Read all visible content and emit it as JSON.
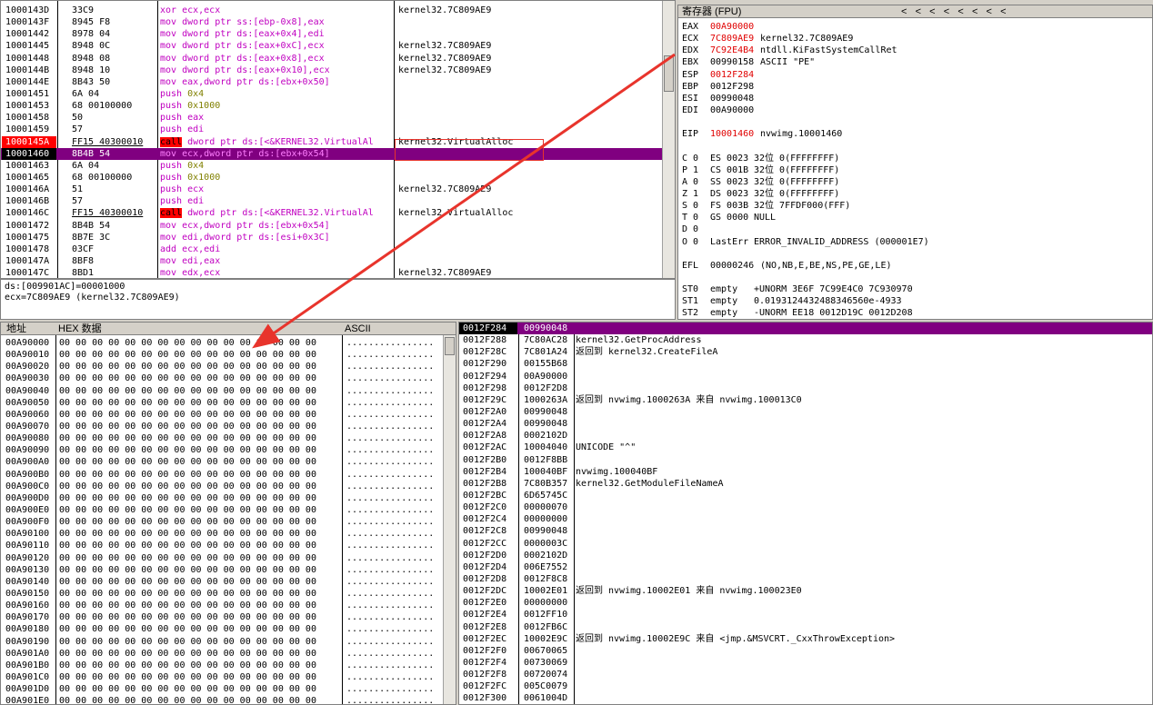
{
  "disasm": {
    "rows": [
      {
        "addr": "1000143D",
        "hex": "33C9",
        "asm": [
          [
            "kw",
            "xor"
          ],
          [
            "b",
            " ecx,ecx"
          ]
        ],
        "cmt": "kernel32.7C809AE9"
      },
      {
        "addr": "1000143F",
        "hex": "8945 F8",
        "asm": [
          [
            "kw",
            "mov"
          ],
          [
            "b",
            " dword ptr ss:[ebp-0x8],eax"
          ]
        ],
        "cmt": ""
      },
      {
        "addr": "10001442",
        "hex": "8978 04",
        "asm": [
          [
            "kw",
            "mov"
          ],
          [
            "b",
            " dword ptr ds:[eax+0x4],edi"
          ]
        ],
        "cmt": ""
      },
      {
        "addr": "10001445",
        "hex": "8948 0C",
        "asm": [
          [
            "kw",
            "mov"
          ],
          [
            "b",
            " dword ptr ds:[eax+0xC],ecx"
          ]
        ],
        "cmt": "kernel32.7C809AE9"
      },
      {
        "addr": "10001448",
        "hex": "8948 08",
        "asm": [
          [
            "kw",
            "mov"
          ],
          [
            "b",
            " dword ptr ds:[eax+0x8],ecx"
          ]
        ],
        "cmt": "kernel32.7C809AE9"
      },
      {
        "addr": "1000144B",
        "hex": "8948 10",
        "asm": [
          [
            "kw",
            "mov"
          ],
          [
            "b",
            " dword ptr ds:[eax+0x10],ecx"
          ]
        ],
        "cmt": "kernel32.7C809AE9"
      },
      {
        "addr": "1000144E",
        "hex": "8B43 50",
        "asm": [
          [
            "kw",
            "mov"
          ],
          [
            "b",
            " eax,dword ptr ds:[ebx+0x50]"
          ]
        ],
        "cmt": ""
      },
      {
        "addr": "10001451",
        "hex": "6A 04",
        "asm": [
          [
            "p",
            "push"
          ],
          [
            "o",
            " 0x4"
          ]
        ],
        "cmt": ""
      },
      {
        "addr": "10001453",
        "hex": "68 00100000",
        "asm": [
          [
            "p",
            "push"
          ],
          [
            "o",
            " 0x1000"
          ]
        ],
        "cmt": ""
      },
      {
        "addr": "10001458",
        "hex": "50",
        "asm": [
          [
            "p",
            "push"
          ],
          [
            "b",
            " eax"
          ]
        ],
        "cmt": ""
      },
      {
        "addr": "10001459",
        "hex": "57",
        "asm": [
          [
            "p",
            "push"
          ],
          [
            "b",
            " edi"
          ]
        ],
        "cmt": ""
      },
      {
        "addr": "1000145A",
        "hex": "FF15 40300010",
        "asm": [
          [
            "call",
            "call"
          ],
          [
            "b",
            " dword ptr ds:[<&KERNEL32.VirtualAl"
          ]
        ],
        "cmt": "kernel32.VirtualAlloc",
        "mark": "bp"
      },
      {
        "addr": "10001460",
        "hex": "8B4B 54",
        "asm": [
          [
            "kw",
            "mov"
          ],
          [
            "b",
            " ecx,dword ptr ds:[ebx+0x54]"
          ]
        ],
        "cmt": "",
        "mark": "eip"
      },
      {
        "addr": "10001463",
        "hex": "6A 04",
        "asm": [
          [
            "p",
            "push"
          ],
          [
            "o",
            " 0x4"
          ]
        ],
        "cmt": ""
      },
      {
        "addr": "10001465",
        "hex": "68 00100000",
        "asm": [
          [
            "p",
            "push"
          ],
          [
            "o",
            " 0x1000"
          ]
        ],
        "cmt": ""
      },
      {
        "addr": "1000146A",
        "hex": "51",
        "asm": [
          [
            "p",
            "push"
          ],
          [
            "b",
            " ecx"
          ]
        ],
        "cmt": "kernel32.7C809AE9"
      },
      {
        "addr": "1000146B",
        "hex": "57",
        "asm": [
          [
            "p",
            "push"
          ],
          [
            "b",
            " edi"
          ]
        ],
        "cmt": ""
      },
      {
        "addr": "1000146C",
        "hex": "FF15 40300010",
        "asm": [
          [
            "call",
            "call"
          ],
          [
            "b",
            " dword ptr ds:[<&KERNEL32.VirtualAl"
          ]
        ],
        "cmt": "kernel32.VirtualAlloc"
      },
      {
        "addr": "10001472",
        "hex": "8B4B 54",
        "asm": [
          [
            "kw",
            "mov"
          ],
          [
            "b",
            " ecx,dword ptr ds:[ebx+0x54]"
          ]
        ],
        "cmt": ""
      },
      {
        "addr": "10001475",
        "hex": "8B7E 3C",
        "asm": [
          [
            "kw",
            "mov"
          ],
          [
            "b",
            " edi,dword ptr ds:[esi+0x3C]"
          ]
        ],
        "cmt": ""
      },
      {
        "addr": "10001478",
        "hex": "03CF",
        "asm": [
          [
            "kw",
            "add"
          ],
          [
            "b",
            " ecx,edi"
          ]
        ],
        "cmt": ""
      },
      {
        "addr": "1000147A",
        "hex": "8BF8",
        "asm": [
          [
            "kw",
            "mov"
          ],
          [
            "b",
            " edi,eax"
          ]
        ],
        "cmt": ""
      },
      {
        "addr": "1000147C",
        "hex": "8BD1",
        "asm": [
          [
            "kw",
            "mov"
          ],
          [
            "b",
            " edx,ecx"
          ]
        ],
        "cmt": "kernel32.7C809AE9"
      }
    ],
    "info1": "ds:[009901AC]=00001000",
    "info2": "ecx=7C809AE9 (kernel32.7C809AE9)"
  },
  "registers": {
    "title": "寄存器 (FPU)",
    "arrows": "<   <   <   <   <   <   <   <",
    "lines": [
      {
        "n": "EAX",
        "v": "00A90000",
        "vc": "red",
        "c": ""
      },
      {
        "n": "ECX",
        "v": "7C809AE9",
        "vc": "red",
        "c": "kernel32.7C809AE9"
      },
      {
        "n": "EDX",
        "v": "7C92E4B4",
        "vc": "red",
        "c": "ntdll.KiFastSystemCallRet"
      },
      {
        "n": "EBX",
        "v": "00990158",
        "vc": "",
        "c": "ASCII \"PE\""
      },
      {
        "n": "ESP",
        "v": "0012F284",
        "vc": "red",
        "c": ""
      },
      {
        "n": "EBP",
        "v": "0012F298",
        "vc": "",
        "c": ""
      },
      {
        "n": "ESI",
        "v": "00990048",
        "vc": "",
        "c": ""
      },
      {
        "n": "EDI",
        "v": "00A90000",
        "vc": "",
        "c": ""
      },
      {
        "n": "",
        "v": "",
        "vc": "",
        "c": ""
      },
      {
        "n": "EIP",
        "v": "10001460",
        "vc": "red",
        "c": "nvwimg.10001460"
      },
      {
        "n": "",
        "v": "",
        "vc": "",
        "c": ""
      },
      {
        "n": "C 0",
        "v": "ES 0023",
        "vc": "",
        "c": "32位 0(FFFFFFFF)"
      },
      {
        "n": "P 1",
        "v": "CS 001B",
        "vc": "",
        "c": "32位 0(FFFFFFFF)"
      },
      {
        "n": "A 0",
        "v": "SS 0023",
        "vc": "",
        "c": "32位 0(FFFFFFFF)"
      },
      {
        "n": "Z 1",
        "v": "DS 0023",
        "vc": "",
        "c": "32位 0(FFFFFFFF)"
      },
      {
        "n": "S 0",
        "v": "FS 003B",
        "vc": "",
        "c": "32位 7FFDF000(FFF)"
      },
      {
        "n": "T 0",
        "v": "GS 0000",
        "vc": "",
        "c": "NULL"
      },
      {
        "n": "D 0",
        "v": "",
        "vc": "",
        "c": ""
      },
      {
        "n": "O 0",
        "v": "LastErr",
        "vc": "",
        "c": "ERROR_INVALID_ADDRESS (000001E7)"
      },
      {
        "n": "",
        "v": "",
        "vc": "",
        "c": ""
      },
      {
        "n": "EFL",
        "v": "00000246",
        "vc": "",
        "c": "(NO,NB,E,BE,NS,PE,GE,LE)"
      },
      {
        "n": "",
        "v": "",
        "vc": "",
        "c": ""
      },
      {
        "n": "ST0",
        "v": "empty",
        "vc": "",
        "c": "+UNORM 3E6F 7C99E4C0 7C930970"
      },
      {
        "n": "ST1",
        "v": "empty",
        "vc": "",
        "c": "0.0193124432488346560e-4933"
      },
      {
        "n": "ST2",
        "v": "empty",
        "vc": "",
        "c": "-UNORM EE18 0012D19C 0012D208"
      },
      {
        "n": "ST3",
        "v": "empty",
        "vc": "",
        "c": "+UNORM 0045 0012D1AC 0012D002"
      },
      {
        "n": "ST4",
        "v": "empty",
        "vc": "",
        "c": "-UNORM D2B0 005BAF28 008C008A"
      }
    ]
  },
  "dump": {
    "col_addr": "地址",
    "col_hex": "HEX 数据",
    "col_ascii": "ASCII",
    "hexline": "00 00 00 00 00 00 00 00 00 00 00 00 00 00 00 00",
    "asciiline": "................",
    "addrs": [
      "00A90000",
      "00A90010",
      "00A90020",
      "00A90030",
      "00A90040",
      "00A90050",
      "00A90060",
      "00A90070",
      "00A90080",
      "00A90090",
      "00A900A0",
      "00A900B0",
      "00A900C0",
      "00A900D0",
      "00A900E0",
      "00A900F0",
      "00A90100",
      "00A90110",
      "00A90120",
      "00A90130",
      "00A90140",
      "00A90150",
      "00A90160",
      "00A90170",
      "00A90180",
      "00A90190",
      "00A901A0",
      "00A901B0",
      "00A901C0",
      "00A901D0",
      "00A901E0"
    ]
  },
  "stack": {
    "rows": [
      {
        "a": "0012F284",
        "v": "00990048",
        "c": "",
        "sel": true
      },
      {
        "a": "0012F288",
        "v": "7C80AC28",
        "c": "kernel32.GetProcAddress"
      },
      {
        "a": "0012F28C",
        "v": "7C801A24",
        "c": "返回到 kernel32.CreateFileA"
      },
      {
        "a": "0012F290",
        "v": "00155B68",
        "c": ""
      },
      {
        "a": "0012F294",
        "v": "00A90000",
        "c": ""
      },
      {
        "a": "0012F298",
        "v": "0012F2D8",
        "c": ""
      },
      {
        "a": "0012F29C",
        "v": "1000263A",
        "c": "返回到 nvwimg.1000263A 来自 nvwimg.100013C0"
      },
      {
        "a": "0012F2A0",
        "v": "00990048",
        "c": ""
      },
      {
        "a": "0012F2A4",
        "v": "00990048",
        "c": ""
      },
      {
        "a": "0012F2A8",
        "v": "0002102D",
        "c": ""
      },
      {
        "a": "0012F2AC",
        "v": "10004040",
        "c": "UNICODE \"^\""
      },
      {
        "a": "0012F2B0",
        "v": "0012F8BB",
        "c": ""
      },
      {
        "a": "0012F2B4",
        "v": "100040BF",
        "c": "nvwimg.100040BF"
      },
      {
        "a": "0012F2B8",
        "v": "7C80B357",
        "c": "kernel32.GetModuleFileNameA"
      },
      {
        "a": "0012F2BC",
        "v": "6D65745C",
        "c": ""
      },
      {
        "a": "0012F2C0",
        "v": "00000070",
        "c": ""
      },
      {
        "a": "0012F2C4",
        "v": "00000000",
        "c": ""
      },
      {
        "a": "0012F2C8",
        "v": "00990048",
        "c": ""
      },
      {
        "a": "0012F2CC",
        "v": "0000003C",
        "c": ""
      },
      {
        "a": "0012F2D0",
        "v": "0002102D",
        "c": ""
      },
      {
        "a": "0012F2D4",
        "v": "006E7552",
        "c": ""
      },
      {
        "a": "0012F2D8",
        "v": "0012F8C8",
        "c": ""
      },
      {
        "a": "0012F2DC",
        "v": "10002E01",
        "c": "返回到 nvwimg.10002E01 来自 nvwimg.100023E0"
      },
      {
        "a": "0012F2E0",
        "v": "00000000",
        "c": ""
      },
      {
        "a": "0012F2E4",
        "v": "0012FF10",
        "c": ""
      },
      {
        "a": "0012F2E8",
        "v": "0012FB6C",
        "c": ""
      },
      {
        "a": "0012F2EC",
        "v": "10002E9C",
        "c": "返回到 nvwimg.10002E9C 来自 <jmp.&MSVCRT._CxxThrowException>"
      },
      {
        "a": "0012F2F0",
        "v": "00670065",
        "c": ""
      },
      {
        "a": "0012F2F4",
        "v": "00730069",
        "c": ""
      },
      {
        "a": "0012F2F8",
        "v": "00720074",
        "c": ""
      },
      {
        "a": "0012F2FC",
        "v": "005C0079",
        "c": ""
      },
      {
        "a": "0012F300",
        "v": "0061004D",
        "c": ""
      }
    ]
  },
  "colors": {
    "arrow": "#e8342c",
    "bp": "#ff0000",
    "eip": "#800080",
    "highlight_box": "#e8342c"
  }
}
